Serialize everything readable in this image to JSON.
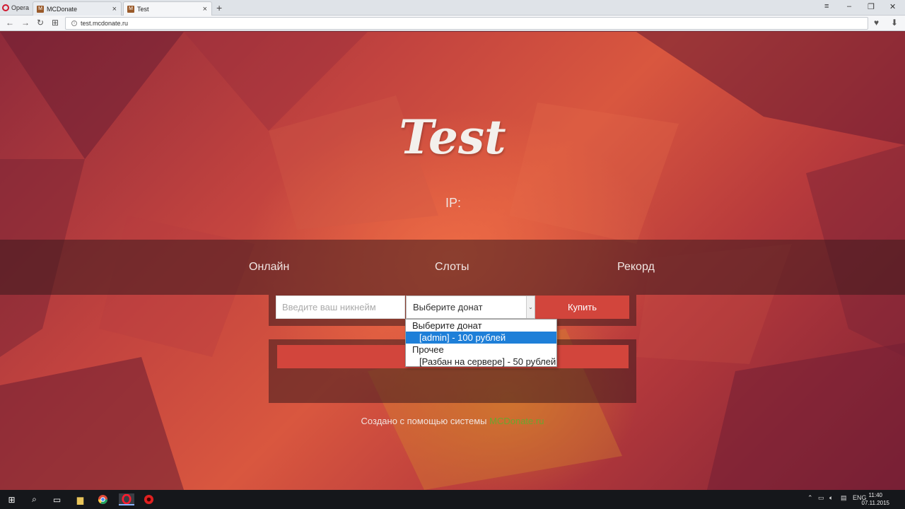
{
  "browser": {
    "menu_label": "Opera",
    "tabs": [
      {
        "label": "MCDonate",
        "close": "×"
      },
      {
        "label": "Test",
        "close": "×"
      }
    ],
    "new_tab": "+",
    "url": "test.mcdonate.ru"
  },
  "page": {
    "title": "Test",
    "ip_label": "IP:",
    "stats": {
      "online": "Онлайн",
      "slots": "Слоты",
      "record": "Рекорд"
    },
    "form": {
      "nickname_placeholder": "Введите ваш никнейм",
      "donate_selected": "Выберите донат",
      "buy_label": "Купить"
    },
    "dropdown_options": [
      {
        "label": "Выберите донат",
        "indent": false,
        "selected": false
      },
      {
        "label": "[admin] - 100 рублей",
        "indent": true,
        "selected": true
      },
      {
        "label": "Прочее",
        "indent": false,
        "selected": false
      },
      {
        "label": "[Разбан на сервере] - 50 рублей",
        "indent": true,
        "selected": false
      }
    ],
    "credit_text": "Создано с помощью системы",
    "credit_link": "MCDonate.ru"
  },
  "taskbar": {
    "language": "ENG",
    "time": "11:40",
    "date": "07.11.2015"
  },
  "colors": {
    "accent_red": "#d2453c",
    "dropdown_highlight": "#1e7fd8",
    "credit_link": "#6aa62f"
  }
}
